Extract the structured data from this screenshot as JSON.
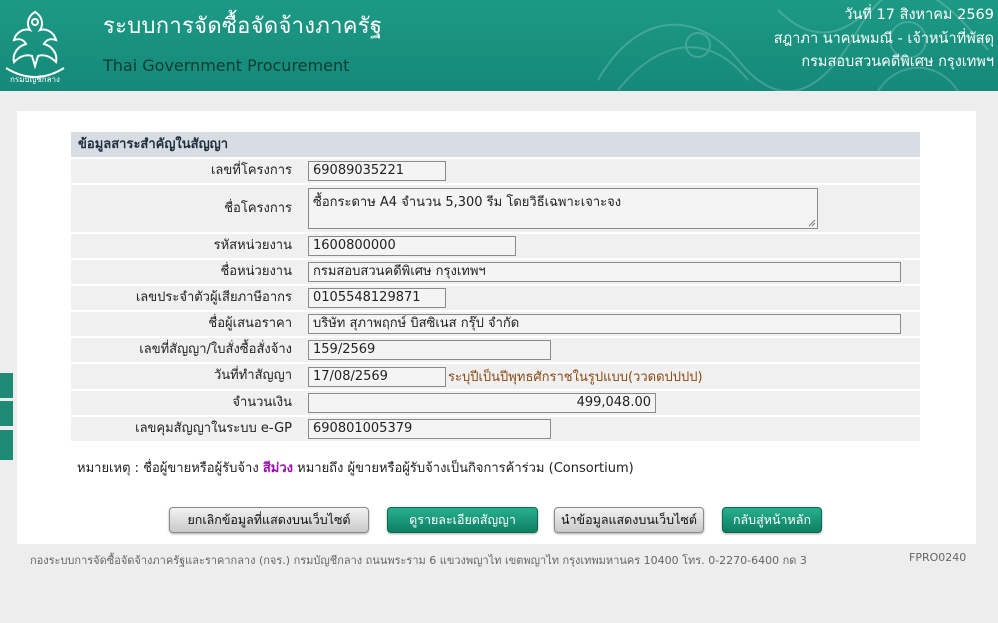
{
  "header": {
    "title_th": "ระบบการจัดซื้อจัดจ้างภาครัฐ",
    "title_en": "Thai Government Procurement",
    "date": "วันที่ 17 สิงหาคม 2569",
    "user": "สฎาภา นาคนพมณี - เจ้าหน้าที่พัสดุ",
    "department": "กรมสอบสวนคดีพิเศษ กรุงเทพฯ",
    "logo_text": "กรมบัญชีกลาง"
  },
  "form": {
    "heading": "ข้อมูลสาระสำคัญในสัญญา",
    "fields": [
      {
        "label": "เลขที่โครงการ",
        "value": "69089035221"
      },
      {
        "label": "ชื่อโครงการ",
        "value": "ซื้อกระดาษ A4 จำนวน 5,300 รีม โดยวิธีเฉพาะเจาะจง"
      },
      {
        "label": "รหัสหน่วยงาน",
        "value": "1600800000"
      },
      {
        "label": "ชื่อหน่วยงาน",
        "value": "กรมสอบสวนคดีพิเศษ กรุงเทพฯ"
      },
      {
        "label": "เลขประจำตัวผู้เสียภาษีอากร",
        "value": "0105548129871"
      },
      {
        "label": "ชื่อผู้เสนอราคา",
        "value": "บริษัท สุภาพฤกษ์ บิสซิเนส กรุ๊ป จำกัด"
      },
      {
        "label": "เลขที่สัญญา/ใบสั่งซื้อสั่งจ้าง",
        "value": "159/2569"
      },
      {
        "label": "วันที่ทำสัญญา",
        "value": "17/08/2569",
        "hint": "ระบุปีเป็นปีพุทธศักราชในรูปแบบ(ววดดปปปป)"
      },
      {
        "label": "จำนวนเงิน",
        "value": "499,048.00"
      },
      {
        "label": "เลขคุมสัญญาในระบบ e-GP",
        "value": "690801005379"
      }
    ]
  },
  "note": {
    "prefix": "หมายเหตุ : ชื่อผู้ขายหรือผู้รับจ้าง",
    "highlight": "สีม่วง",
    "suffix": "หมายถึง ผู้ขายหรือผู้รับจ้างเป็นกิจการค้าร่วม (Consortium)",
    "highlight_color": "#9b0fb0"
  },
  "buttons": {
    "cancel_publish": "ยกเลิกข้อมูลที่แสดงบนเว็บไซต์",
    "view_contract": "ดูรายละเอียดสัญญา",
    "publish": "นำข้อมูลแสดงบนเว็บไซต์",
    "back_home": "กลับสู่หน้าหลัก"
  },
  "footer": {
    "address": "กองระบบการจัดซื้อจัดจ้างภาครัฐและราคากลาง (กจร.) กรมบัญชีกลาง ถนนพระราม 6 แขวงพญาไท เขตพญาไท กรุงเทพมหานคร 10400 โทร. 0-2270-6400 กด 3",
    "code": "FPRO0240"
  },
  "colors": {
    "header_bg": "#1c9a84",
    "accent_green": "#0d7f63",
    "form_header": "#d8dde4"
  }
}
